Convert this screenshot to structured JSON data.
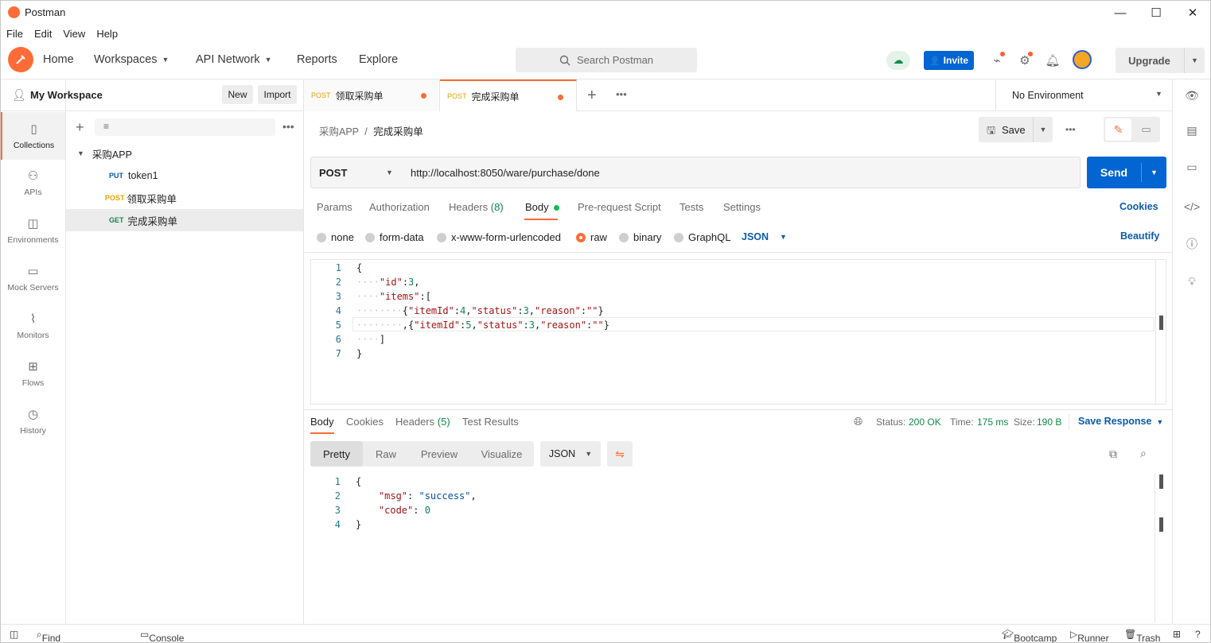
{
  "window": {
    "title": "Postman",
    "minimize": "—",
    "maximize": "☐",
    "close": "✕"
  },
  "menu": [
    "File",
    "Edit",
    "View",
    "Help"
  ],
  "header": {
    "nav": {
      "home": "Home",
      "workspaces": "Workspaces",
      "api_network": "API Network",
      "reports": "Reports",
      "explore": "Explore"
    },
    "search_placeholder": "Search Postman",
    "invite": "Invite",
    "upgrade": "Upgrade"
  },
  "rail": {
    "collections": "Collections",
    "apis": "APIs",
    "environments": "Environments",
    "mock_servers": "Mock Servers",
    "monitors": "Monitors",
    "flows": "Flows",
    "history": "History"
  },
  "sidebar": {
    "workspace": "My Workspace",
    "new": "New",
    "import": "Import",
    "collection": "采购APP",
    "requests": [
      {
        "method": "PUT",
        "name": "token1"
      },
      {
        "method": "POST",
        "name": "领取采购单"
      },
      {
        "method": "GET",
        "name": "完成采购单"
      }
    ]
  },
  "tabs": [
    {
      "method": "POST",
      "name": "领取采购单"
    },
    {
      "method": "POST",
      "name": "完成采购单"
    }
  ],
  "environment": "No Environment",
  "breadcrumb": {
    "parent": "采购APP",
    "separator": "/",
    "current": "完成采购单"
  },
  "save": "Save",
  "request": {
    "method": "POST",
    "url": "http://localhost:8050/ware/purchase/done",
    "send": "Send"
  },
  "request_tabs": {
    "params": "Params",
    "authorization": "Authorization",
    "headers": "Headers",
    "headers_count": "(8)",
    "body": "Body",
    "prerequest": "Pre-request Script",
    "tests": "Tests",
    "settings": "Settings",
    "cookies": "Cookies"
  },
  "body_types": {
    "none": "none",
    "form_data": "form-data",
    "urlencoded": "x-www-form-urlencoded",
    "raw": "raw",
    "binary": "binary",
    "graphql": "GraphQL",
    "format": "JSON",
    "beautify": "Beautify"
  },
  "request_body_lines": [
    "1",
    "2",
    "3",
    "4",
    "5",
    "6",
    "7"
  ],
  "response_tabs": {
    "body": "Body",
    "cookies": "Cookies",
    "headers": "Headers",
    "headers_count": "(5)",
    "test_results": "Test Results"
  },
  "response_meta": {
    "status_label": "Status:",
    "status": "200 OK",
    "time_label": "Time:",
    "time": "175 ms",
    "size_label": "Size:",
    "size": "190 B",
    "save_response": "Save Response"
  },
  "response_view": {
    "pretty": "Pretty",
    "raw": "Raw",
    "preview": "Preview",
    "visualize": "Visualize",
    "format": "JSON"
  },
  "response_body_lines": [
    "1",
    "2",
    "3",
    "4"
  ],
  "statusbar": {
    "find_replace": "Find and Replace",
    "console": "Console",
    "bootcamp": "Bootcamp",
    "runner": "Runner",
    "trash": "Trash"
  },
  "colors": {
    "brand": "#ff6c37",
    "primary": "#0265d2",
    "success": "#0e8a4a"
  }
}
